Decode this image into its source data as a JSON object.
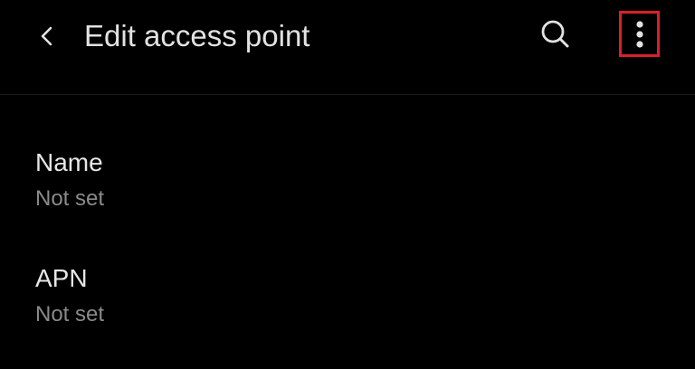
{
  "header": {
    "title": "Edit access point",
    "back_icon": "chevron-left-icon",
    "search_icon": "search-icon",
    "more_icon": "more-vert-icon",
    "highlight_color": "#d9202a"
  },
  "preferences": [
    {
      "title": "Name",
      "summary": "Not set"
    },
    {
      "title": "APN",
      "summary": "Not set"
    }
  ],
  "colors": {
    "background": "#000000",
    "text_primary": "#e6e6e6",
    "text_secondary": "#8a8a8a"
  }
}
